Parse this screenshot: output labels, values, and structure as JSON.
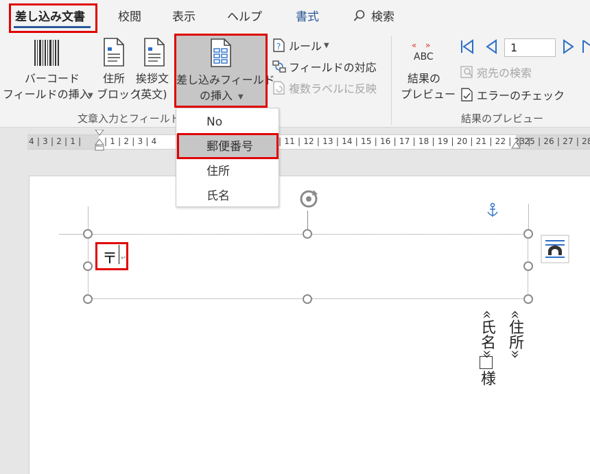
{
  "tabs": {
    "mailings": "差し込み文書",
    "review": "校閲",
    "view": "表示",
    "help": "ヘルプ",
    "format": "書式",
    "search": "検索"
  },
  "ribbon": {
    "barcode_line1": "バーコード",
    "barcode_line2": "フィールドの挿入",
    "address_line1": "住所",
    "address_line2": "ブロック",
    "greeting_line1": "挨拶文",
    "greeting_line2": "(英文)",
    "insert_field_line1": "差し込みフィールド",
    "insert_field_line2": "の挿入",
    "rules": "ルール",
    "match_fields": "フィールドの対応",
    "update_labels": "複数ラベルに反映",
    "group_write_insert": "文章入力とフィールド",
    "preview_icon_text": "ABC",
    "preview_results_line1": "結果の",
    "preview_results_line2": "プレビュー",
    "record_number": "1",
    "find_recipient": "宛先の検索",
    "check_errors": "エラーのチェック",
    "group_preview": "結果のプレビュー"
  },
  "ruler": {
    "left_part": "4 | 3 | 2 | 1 |",
    "middle_part": "| 1 | 2 | 3 | 4",
    "right_part": "| 11 | 12 | 13 | 14 | 15 | 16 | 17 | 18 | 19 | 20 | 21 | 22 | 23 |",
    "end_part": "| 25 | 26 | 27 | 28"
  },
  "dropdown": {
    "items": [
      "No",
      "郵便番号",
      "住所",
      "氏名"
    ]
  },
  "document": {
    "postal_mark": "〒",
    "address_field": "«住所»",
    "name_field": "«氏名»",
    "box_char": "□",
    "sama": "様"
  },
  "colors": {
    "accent": "#2b579a",
    "highlight_border": "#e00000",
    "nav_blue": "#2b6fc8"
  }
}
